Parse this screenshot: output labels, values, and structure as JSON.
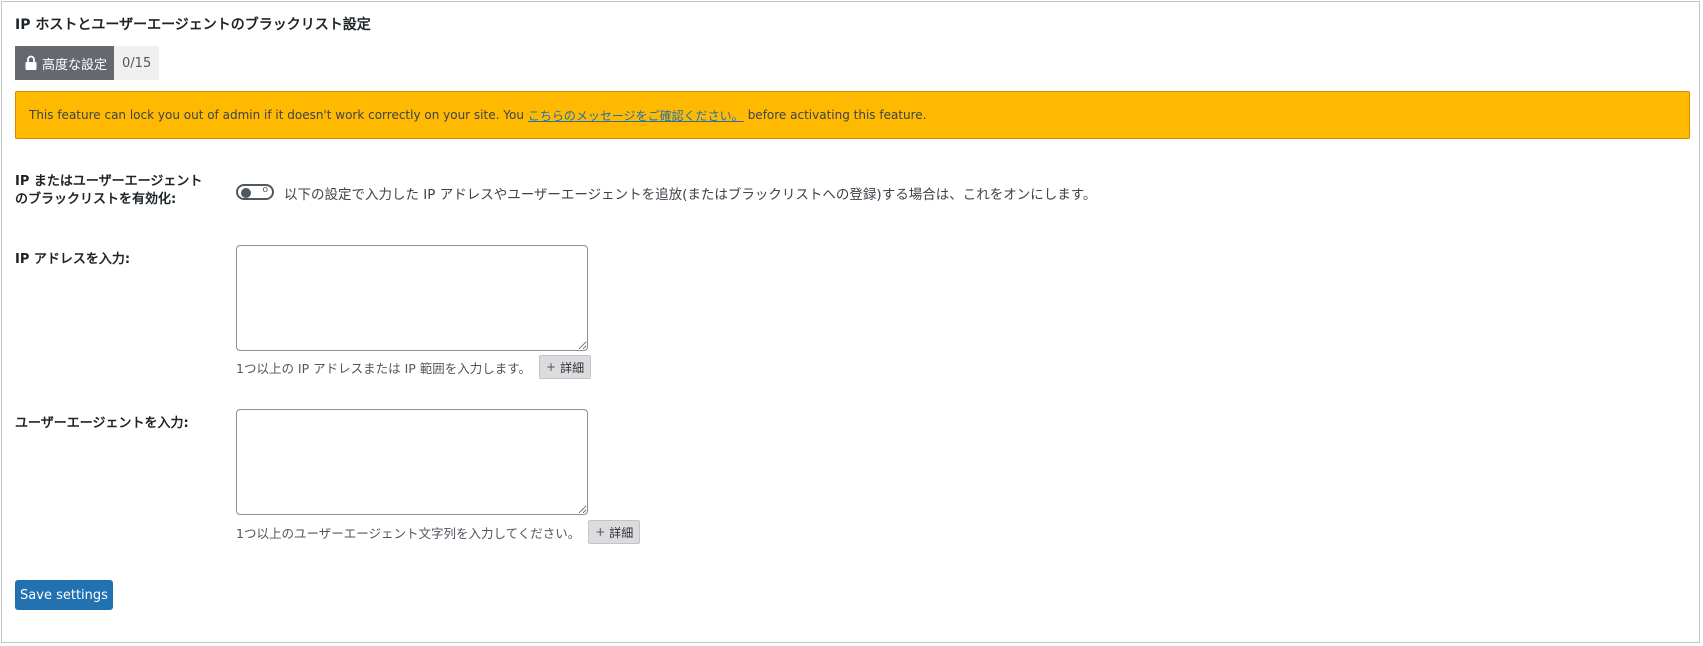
{
  "panel": {
    "title": "IP ホストとユーザーエージェントのブラックリスト設定"
  },
  "badge": {
    "level_label": "高度な設定",
    "count": "0/15",
    "icon": "lock-icon"
  },
  "warning": {
    "text_before": "This feature can lock you out of admin if it doesn't work correctly on your site. You",
    "link_text": "こちらのメッセージをご確認ください。",
    "text_after": "before activating this feature.",
    "color": "#ffb900"
  },
  "enable_row": {
    "label": "IP またはユーザーエージェントのブラックリストを有効化:",
    "toggle_state_text": "o",
    "description": "以下の設定で入力した IP アドレスやユーザーエージェントを追放(またはブラックリストへの登録)する場合は、これをオンにします。"
  },
  "ip_row": {
    "label": "IP アドレスを入力:",
    "value": "",
    "hint": "1つ以上の IP アドレスまたは IP 範囲を入力します。",
    "details_label": "詳細"
  },
  "ua_row": {
    "label": "ユーザーエージェントを入力:",
    "value": "",
    "hint": "1つ以上のユーザーエージェント文字列を入力してください。",
    "details_label": "詳細"
  },
  "save_button": {
    "label": "Save settings",
    "color": "#2271b1"
  }
}
